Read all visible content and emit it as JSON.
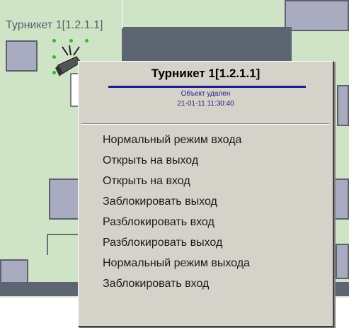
{
  "map": {
    "turnstile_label": "Турникет 1[1.2.1.1]"
  },
  "context_menu": {
    "title": "Турникет 1[1.2.1.1]",
    "status": "Объект удален",
    "timestamp": "21-01-11 11:30:40",
    "items": [
      {
        "label": "Нормальный режим входа"
      },
      {
        "label": "Открыть на выход"
      },
      {
        "label": "Открыть на вход"
      },
      {
        "label": "Заблокировать выход"
      },
      {
        "label": "Разблокировать вход"
      },
      {
        "label": "Разблокировать выход"
      },
      {
        "label": "Нормальный режим выхода"
      },
      {
        "label": "Заблокировать вход"
      }
    ]
  },
  "colors": {
    "map_background": "#cfe4c6",
    "menu_background": "#d5d2ca",
    "title_underline": "#1e1e8a",
    "status_text": "#1e1e8a",
    "selection_handles": "#2fb92f"
  },
  "icons": {
    "turnstile": "turnstile-icon"
  }
}
